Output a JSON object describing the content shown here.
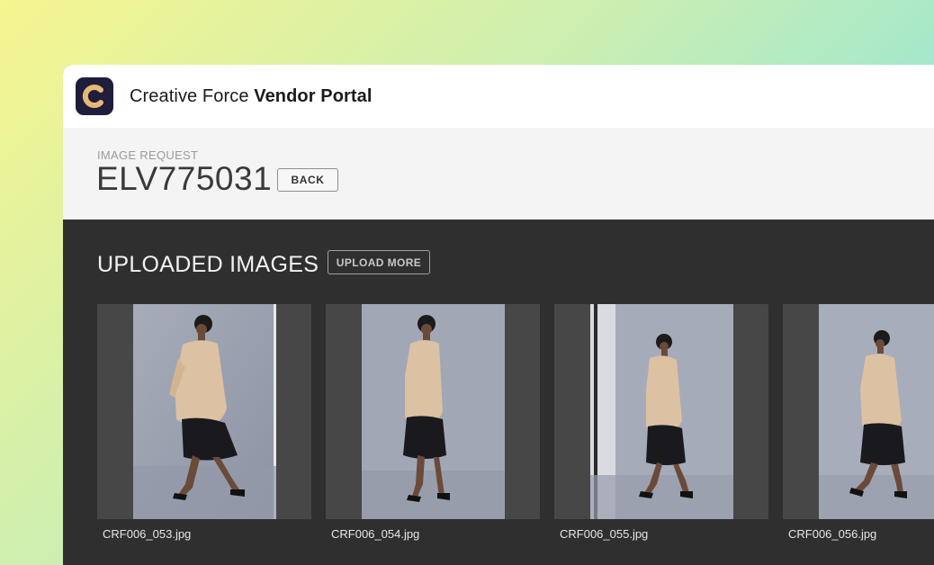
{
  "app": {
    "title_prefix": "Creative Force",
    "title_bold": "Vendor Portal",
    "logo_icon": "creative-force-logo"
  },
  "request": {
    "label": "IMAGE REQUEST",
    "id": "ELV775031",
    "back_label": "BACK"
  },
  "uploads": {
    "title": "UPLOADED IMAGES",
    "upload_more_label": "UPLOAD MORE",
    "images": [
      {
        "filename": "CRF006_053.jpg"
      },
      {
        "filename": "CRF006_054.jpg"
      },
      {
        "filename": "CRF006_055.jpg"
      },
      {
        "filename": "CRF006_056.jpg"
      }
    ]
  },
  "colors": {
    "logo_bg": "#1f1d3c",
    "logo_accent": "#e9b872",
    "dark_bg": "#2f2f2f",
    "header_bg": "#f4f4f4"
  }
}
